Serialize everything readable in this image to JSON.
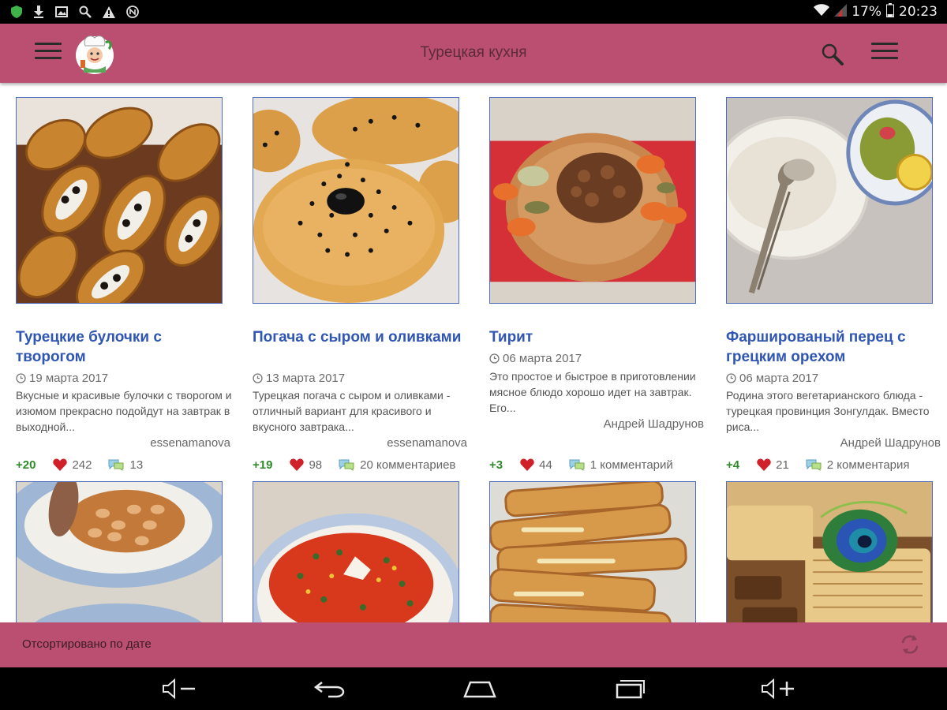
{
  "status_bar": {
    "battery": "17%",
    "time": "20:23",
    "icons": [
      "shield-icon",
      "download-icon",
      "image-icon",
      "search-icon",
      "warning-icon",
      "n-icon",
      "wifi-icon",
      "signal-icon",
      "battery-icon"
    ]
  },
  "app_bar": {
    "title": "Турецкая кухня",
    "menu_icon": "hamburger-icon",
    "logo": "chef-logo",
    "search_icon": "search-icon",
    "overflow_icon": "menu-icon"
  },
  "colors": {
    "accent": "#bb4f72",
    "title_link": "#2f55b5",
    "score": "#2f8a2b",
    "heart": "#d0202a"
  },
  "cards": [
    {
      "title": "Турецкие булочки с творогом",
      "date": "19 марта 2017",
      "description": "Вкусные и красивые булочки с творогом и изюмом прекрасно подойдут на завтрак в выходной...",
      "author": "essenamanova",
      "score": "+20",
      "likes": "242",
      "comments": "13"
    },
    {
      "title": "Погача с сыром и оливками",
      "date": "13 марта 2017",
      "description": "Турецкая погача с сыром и оливками - отличный вариант для красивого и вкусного завтрака...",
      "author": "essenamanova",
      "score": "+19",
      "likes": "98",
      "comments": "20 комментариев"
    },
    {
      "title": "Тирит",
      "date": "06 марта 2017",
      "description": "Это простое и быстрое в приготовлении мясное блюдо хорошо идет на завтрак. Его...",
      "author": "Андрей Шадрунов",
      "score": "+3",
      "likes": "44",
      "comments": "1 комментарий"
    },
    {
      "title": "Фаршированый перец с грецким орехом",
      "date": "06 марта 2017",
      "description": "Родина этого вегетарианского блюда - турецкая провинция Зонгулдак. Вместо риса...",
      "author": "Андрей Шадрунов",
      "score": "+4",
      "likes": "21",
      "comments": "2 комментария"
    }
  ],
  "bottom_bar": {
    "sort_label": "Отсортировано по дате",
    "refresh_icon": "refresh-icon"
  },
  "nav_bar": {
    "buttons": [
      "volume-down-icon",
      "back-icon",
      "home-icon",
      "recents-icon",
      "volume-up-icon"
    ]
  }
}
